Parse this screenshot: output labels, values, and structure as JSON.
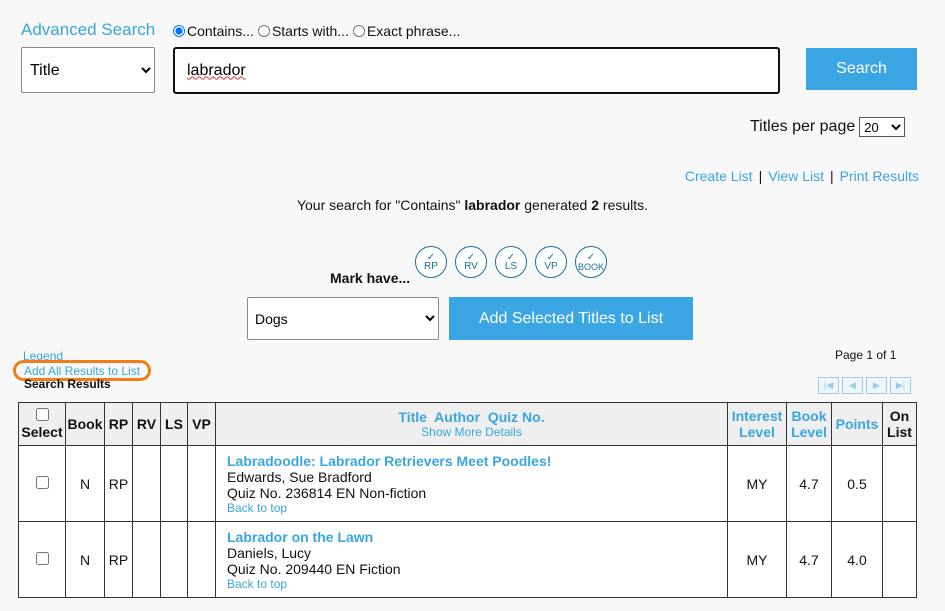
{
  "header": {
    "title": "Advanced Search",
    "radios": [
      {
        "label": "Contains...",
        "checked": true
      },
      {
        "label": "Starts with...",
        "checked": false
      },
      {
        "label": "Exact phrase...",
        "checked": false
      }
    ],
    "field_select": "Title",
    "search_value": "labrador",
    "search_button": "Search"
  },
  "titles_per_page": {
    "label": "Titles per page",
    "value": "20"
  },
  "list_links": {
    "create": "Create List",
    "view": "View List",
    "print": "Print Results",
    "sep": "|"
  },
  "result_summary": {
    "prefix": "Your search for \"Contains\" ",
    "term": "labrador",
    "middle": " generated ",
    "count": "2",
    "suffix": " results."
  },
  "mark_have": {
    "label": "Mark have...",
    "check": "✓",
    "items": [
      "RP",
      "RV",
      "LS",
      "VP",
      "BOOK"
    ]
  },
  "list_select": "Dogs",
  "add_selected_button": "Add Selected Titles to List",
  "legend": "Legend",
  "add_all": "Add All Results to List",
  "search_results_label": "Search Results",
  "page_of": "Page 1 of 1",
  "pager_icons": [
    "first-page-icon",
    "prev-page-icon",
    "next-page-icon",
    "last-page-icon"
  ],
  "table": {
    "headers": {
      "select": "Select",
      "book": "Book",
      "rp": "RP",
      "rv": "RV",
      "ls": "LS",
      "vp": "VP",
      "title": "Title  Author  Quiz No.",
      "show_more": "Show More Details",
      "interest": "Interest Level",
      "book_level": "Book Level",
      "points": "Points",
      "on_list": "On List"
    },
    "rows": [
      {
        "book": "N",
        "rp": "RP",
        "rv": "",
        "ls": "",
        "vp": "",
        "title": "Labradoodle: Labrador Retrievers Meet Poodles!",
        "author": "Edwards, Sue Bradford",
        "quiz": "Quiz No. 236814 EN Non-fiction",
        "back": "Back to top",
        "interest": "MY",
        "book_level": "4.7",
        "points": "0.5",
        "on_list": ""
      },
      {
        "book": "N",
        "rp": "RP",
        "rv": "",
        "ls": "",
        "vp": "",
        "title": "Labrador on the Lawn",
        "author": "Daniels, Lucy",
        "quiz": "Quiz No. 209440 EN Fiction",
        "back": "Back to top",
        "interest": "MY",
        "book_level": "4.7",
        "points": "4.0",
        "on_list": ""
      }
    ]
  },
  "colors": {
    "accent": "#3aa6e4",
    "highlight": "#f07d1a",
    "circle": "#1e6fa0"
  }
}
